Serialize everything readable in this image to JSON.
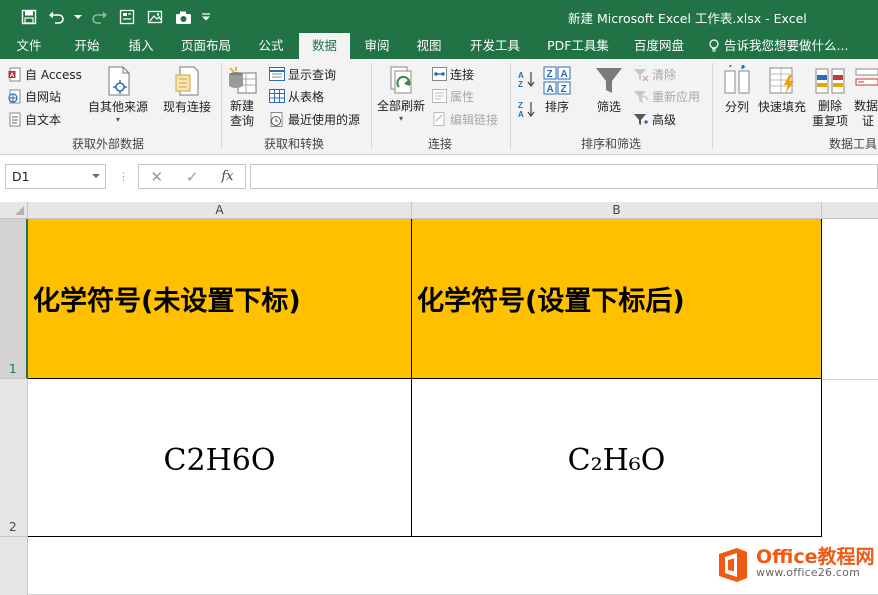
{
  "window": {
    "title": "新建 Microsoft Excel 工作表.xlsx - Excel"
  },
  "qat": {
    "icons": [
      "save-icon",
      "undo-icon",
      "redo-icon",
      "form-icon",
      "picture-icon",
      "camera-icon",
      "customize-qat-icon"
    ]
  },
  "tabs": [
    {
      "label": "文件"
    },
    {
      "label": "开始"
    },
    {
      "label": "插入"
    },
    {
      "label": "页面布局"
    },
    {
      "label": "公式"
    },
    {
      "label": "数据"
    },
    {
      "label": "审阅"
    },
    {
      "label": "视图"
    },
    {
      "label": "开发工具"
    },
    {
      "label": "PDF工具集"
    },
    {
      "label": "百度网盘"
    }
  ],
  "active_tab": "数据",
  "tell_me": "告诉我您想要做什么...",
  "ribbon": {
    "get_external": {
      "access": "自 Access",
      "web": "自网站",
      "text": "自文本",
      "other": "自其他来源",
      "existing": "现有连接",
      "group_label": "获取外部数据"
    },
    "transform": {
      "new_query_1": "新建",
      "new_query_2": "查询",
      "show_queries": "显示查询",
      "from_table": "从表格",
      "recent_sources": "最近使用的源",
      "group_label": "获取和转换"
    },
    "connections": {
      "refresh_all": "全部刷新",
      "connections": "连接",
      "properties": "属性",
      "edit_links": "编辑链接",
      "group_label": "连接"
    },
    "sort_filter": {
      "sort": "排序",
      "filter": "筛选",
      "clear": "清除",
      "reapply": "重新应用",
      "advanced": "高级",
      "group_label": "排序和筛选"
    },
    "data_tools": {
      "text_to_columns": "分列",
      "flash_fill": "快速填充",
      "remove_dup_1": "删除",
      "remove_dup_2": "重复项",
      "validation_1": "数据",
      "validation_2": "证",
      "group_label": "数据工具"
    }
  },
  "formula_bar": {
    "name_box": "D1",
    "formula": ""
  },
  "sheet": {
    "columns": [
      "A",
      "B"
    ],
    "rows": [
      "1",
      "2"
    ],
    "cells": {
      "A1": "化学符号(未设置下标)",
      "B1": "化学符号(设置下标后)",
      "A2": "C2H6O",
      "B2": "C₂H₆O"
    }
  },
  "colors": {
    "excel_green": "#217346",
    "header_fill": "#ffc000",
    "ribbon_bg": "#f3f3f3"
  },
  "watermark": {
    "line1": "Office教程网",
    "line2": "www.office26.com"
  }
}
